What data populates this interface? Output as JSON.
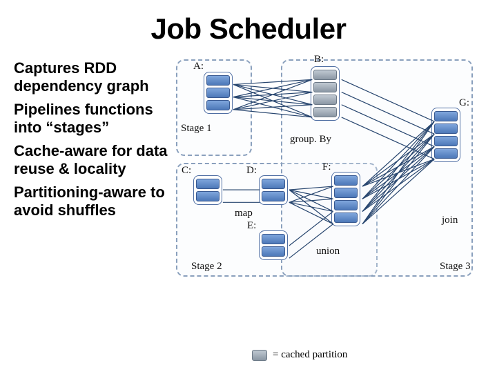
{
  "title": "Job Scheduler",
  "bullets": {
    "b1": "Captures RDD dependency graph",
    "b2": "Pipelines functions into “stages”",
    "b3": "Cache-aware for data reuse & locality",
    "b4": "Partitioning-aware to avoid shuffles"
  },
  "stages": {
    "s1": "Stage 1",
    "s2": "Stage 2",
    "s3": "Stage 3"
  },
  "rdds": {
    "A": "A:",
    "B": "B:",
    "C": "C:",
    "D": "D:",
    "E": "E:",
    "F": "F:",
    "G": "G:"
  },
  "ops": {
    "groupBy": "group. By",
    "map": "map",
    "union": "union",
    "join": "join"
  },
  "legend": {
    "cached": "= cached partition"
  }
}
